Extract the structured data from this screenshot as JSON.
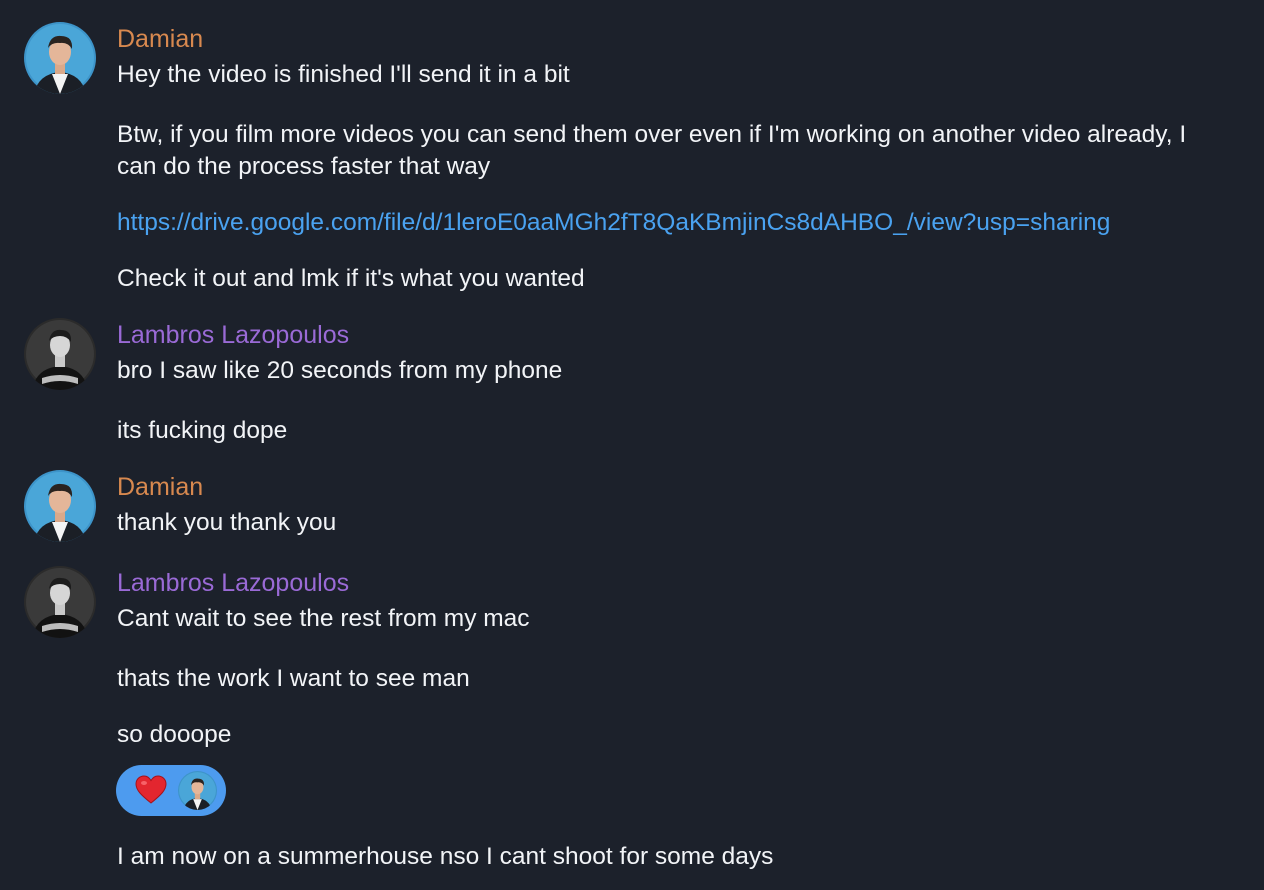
{
  "messages": {
    "g1": {
      "sender": "Damian",
      "lines": [
        "Hey the video is finished I'll send it in a bit",
        "Btw, if you film more videos you can send them over even if I'm working on another video already, I can do the process faster that way",
        "https://drive.google.com/file/d/1leroE0aaMGh2fT8QaKBmjinCs8dAHBO_/view?usp=sharing",
        "Check it out and lmk if it's what you wanted"
      ]
    },
    "g2": {
      "sender": "Lambros Lazopoulos",
      "lines": [
        "bro I saw like 20 seconds from my phone",
        "its fucking dope"
      ]
    },
    "g3": {
      "sender": "Damian",
      "lines": [
        "thank you thank you"
      ]
    },
    "g4": {
      "sender": "Lambros Lazopoulos",
      "lines": [
        "Cant wait to see the rest from my mac",
        "thats the work I want to see man",
        "so dooope"
      ],
      "reaction": {
        "emoji": "heart-icon",
        "reactor_avatar": "damian-avatar"
      }
    },
    "g5": {
      "lines": [
        "I am now on a summerhouse nso I cant shoot for some days"
      ]
    }
  },
  "colors": {
    "background": "#1c212b",
    "damian_name": "#d8894f",
    "lambros_name": "#9a6ad6",
    "link": "#4aa2f0",
    "reaction_bg": "#4d9bef",
    "text": "#f2f4f7"
  }
}
